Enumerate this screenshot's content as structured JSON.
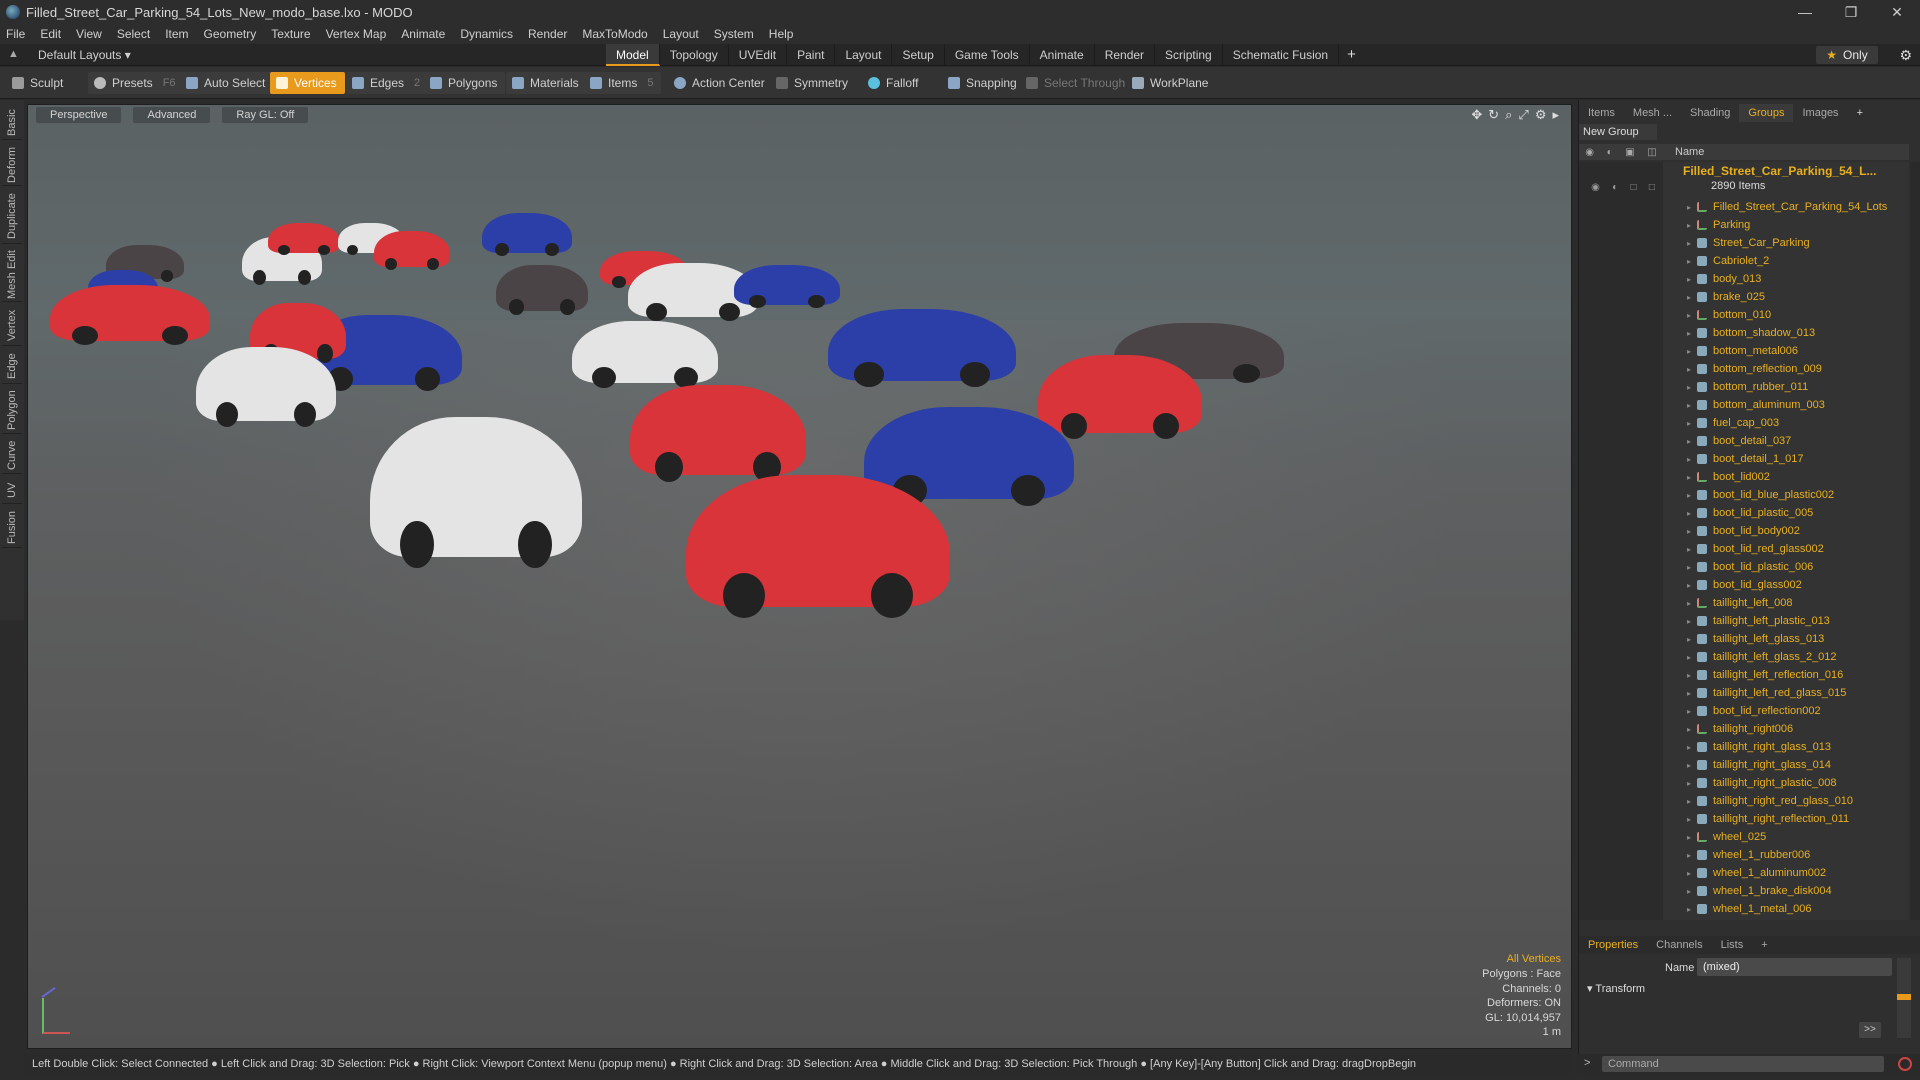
{
  "window": {
    "title": "Filled_Street_Car_Parking_54_Lots_New_modo_base.lxo - MODO",
    "controls": [
      "—",
      "❐",
      "✕"
    ]
  },
  "menu": [
    "File",
    "Edit",
    "View",
    "Select",
    "Item",
    "Geometry",
    "Texture",
    "Vertex Map",
    "Animate",
    "Dynamics",
    "Render",
    "MaxToModo",
    "Layout",
    "System",
    "Help"
  ],
  "layoutbar": {
    "layouts_label": "Default Layouts ▾",
    "tabs": [
      "Model",
      "Topology",
      "UVEdit",
      "Paint",
      "Layout",
      "Setup",
      "Game Tools",
      "Animate",
      "Render",
      "Scripting",
      "Schematic Fusion"
    ],
    "active_tab": "Model",
    "plus": "+",
    "only_label": "Only"
  },
  "toolbar": {
    "sculpt": "Sculpt",
    "presets": "Presets",
    "presets_key": "F6",
    "auto_select": "Auto Select",
    "vertices": "Vertices",
    "edges": "Edges",
    "edges_key": "2",
    "polygons": "Polygons",
    "materials": "Materials",
    "items": "Items",
    "items_key": "5",
    "action_center": "Action Center",
    "symmetry": "Symmetry",
    "falloff": "Falloff",
    "snapping": "Snapping",
    "select_through": "Select Through",
    "workplane": "WorkPlane"
  },
  "left_tabs": [
    "Basic",
    "Deform",
    "Duplicate",
    "Mesh Edit",
    "Vertex",
    "Edge",
    "Polygon",
    "Curve",
    "UV",
    "Fusion"
  ],
  "viewport": {
    "view_mode": "Perspective",
    "shading": "Advanced",
    "raygl": "Ray GL: Off",
    "info": {
      "selection": "All Vertices",
      "polygons": "Polygons : Face",
      "channels": "Channels: 0",
      "deformers": "Deformers: ON",
      "gl": "GL: 10,014,957",
      "scale": "1 m"
    }
  },
  "right_panel": {
    "tabs": [
      "Items",
      "Mesh ...",
      "Shading",
      "Groups",
      "Images",
      "+"
    ],
    "active_tab": "Groups",
    "new_group": "New Group",
    "column_name": "Name",
    "root": "Filled_Street_Car_Parking_54_L...",
    "root_count": "2890 Items",
    "items": [
      "Filled_Street_Car_Parking_54_Lots",
      "Parking",
      "Street_Car_Parking",
      "Cabriolet_2",
      "body_013",
      "brake_025",
      "bottom_010",
      "bottom_shadow_013",
      "bottom_metal006",
      "bottom_reflection_009",
      "bottom_rubber_011",
      "bottom_aluminum_003",
      "fuel_cap_003",
      "boot_detail_037",
      "boot_detail_1_017",
      "boot_lid002",
      "boot_lid_blue_plastic002",
      "boot_lid_plastic_005",
      "boot_lid_body002",
      "boot_lid_red_glass002",
      "boot_lid_plastic_006",
      "boot_lid_glass002",
      "taillight_left_008",
      "taillight_left_plastic_013",
      "taillight_left_glass_013",
      "taillight_left_glass_2_012",
      "taillight_left_reflection_016",
      "taillight_left_red_glass_015",
      "boot_lid_reflection002",
      "taillight_right006",
      "taillight_right_glass_013",
      "taillight_right_glass_014",
      "taillight_right_plastic_008",
      "taillight_right_red_glass_010",
      "taillight_right_reflection_011",
      "wheel_025",
      "wheel_1_rubber006",
      "wheel_1_aluminum002",
      "wheel_1_brake_disk004",
      "wheel_1_metal_006"
    ],
    "properties_tabs": [
      "Properties",
      "Channels",
      "Lists",
      "+"
    ],
    "name_label": "Name",
    "name_value": "(mixed)",
    "transform_label": "Transform",
    "more": ">>"
  },
  "statusbar": "Left Double Click: Select Connected ● Left Click and Drag: 3D Selection: Pick ● Right Click: Viewport Context Menu (popup menu) ● Right Click and Drag: 3D Selection: Area ● Middle Click and Drag: 3D Selection: Pick Through ● [Any Key]-[Any Button] Click and Drag: dragDropBegin",
  "command": {
    "placeholder": "Command",
    "arrow": ">"
  },
  "colors": {
    "accent": "#e89a1c",
    "tree_text": "#e8b020",
    "car_red": "#d8343a",
    "car_blue": "#2c3fa8",
    "car_white": "#e4e4e4",
    "car_dark": "#4b4446"
  }
}
